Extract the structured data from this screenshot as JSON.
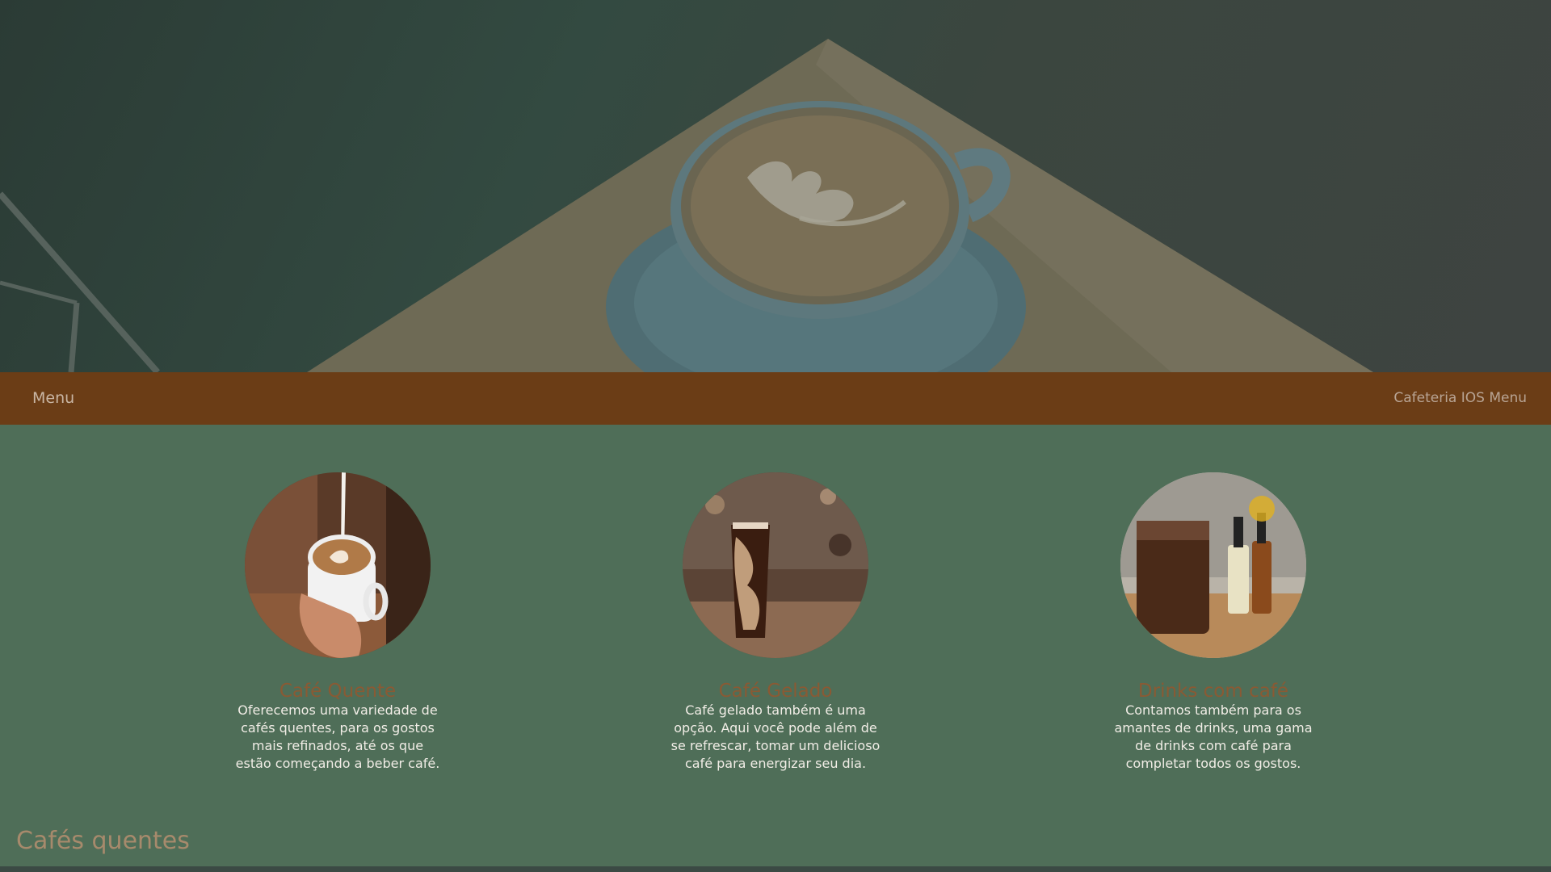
{
  "navbar": {
    "menu_label": "Menu",
    "brand_label": "Cafeteria IOS Menu"
  },
  "cards": [
    {
      "title": "Café Quente",
      "description": "Oferecemos uma variedade de cafés quentes, para os gostos mais refinados, até os que estão começando a beber café.",
      "image": "latte-art-cup-photo"
    },
    {
      "title": "Café Gelado",
      "description": "Café gelado também é uma opção. Aqui você pode além de se refrescar, tomar um delicioso café para energizar seu dia.",
      "image": "iced-coffee-glass-photo"
    },
    {
      "title": "Drinks com café",
      "description": "Contamos também para os amantes de drinks, uma gama de drinks com café para completar todos os gostos.",
      "image": "coffee-drink-bottles-photo"
    }
  ],
  "section": {
    "title": "Cafés quentes"
  },
  "colors": {
    "navbar": "#6b3d16",
    "background": "#4f6e58",
    "card_title": "#8a5a34",
    "section_title": "#a78a6c"
  }
}
